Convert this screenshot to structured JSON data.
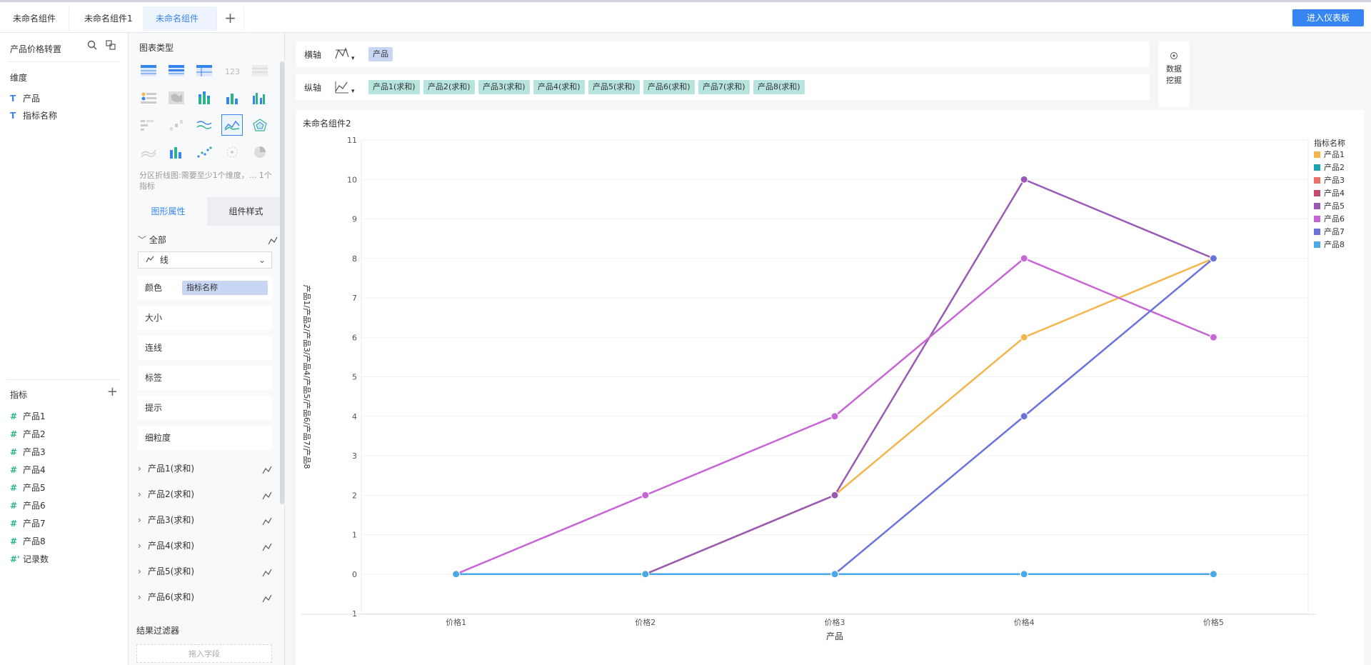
{
  "tabs": [
    {
      "label": "未命名组件",
      "active": false
    },
    {
      "label": "未命名组件1",
      "active": false
    },
    {
      "label": "未命名组件2",
      "active": true
    }
  ],
  "add_tab_label": "+",
  "dashboard_button": "进入仪表板",
  "field_panel": {
    "dataset_name": "产品价格转置",
    "dimension_title": "维度",
    "dimensions": [
      "产品",
      "指标名称"
    ],
    "measure_title": "指标",
    "measures": [
      "产品1",
      "产品2",
      "产品3",
      "产品4",
      "产品5",
      "产品6",
      "产品7",
      "产品8",
      "记录数"
    ]
  },
  "config_panel": {
    "chart_type_title": "图表类型",
    "hint": "分区折线图:需要至少1个维度，... 1个指标",
    "tab_graph": "图形属性",
    "tab_style": "组件样式",
    "all_label": "全部",
    "mark_type": "线",
    "props": {
      "color": "颜色",
      "color_field": "指标名称",
      "size": "大小",
      "connect": "连线",
      "label": "标签",
      "tooltip": "提示",
      "granularity": "细粒度"
    },
    "series": [
      "产品1(求和)",
      "产品2(求和)",
      "产品3(求和)",
      "产品4(求和)",
      "产品5(求和)",
      "产品6(求和)"
    ],
    "filter_title": "结果过滤器",
    "drop_hint": "拖入字段"
  },
  "shelves": {
    "x_label": "横轴",
    "x_pills": [
      "产品"
    ],
    "y_label": "纵轴",
    "y_pills": [
      "产品1(求和)",
      "产品2(求和)",
      "产品3(求和)",
      "产品4(求和)",
      "产品5(求和)",
      "产品6(求和)",
      "产品7(求和)",
      "产品8(求和)"
    ]
  },
  "mining_label": "数据挖掘",
  "chart_title": "未命名组件2",
  "chart_data": {
    "type": "line",
    "categories": [
      "价格1",
      "价格2",
      "价格3",
      "价格4",
      "价格5"
    ],
    "xlabel": "产品",
    "ylabel": "产品1/产品2/产品3/产品4/产品5/产品6/产品7/产品8",
    "ylim": [
      -1,
      11
    ],
    "yticks": [
      -1,
      0,
      1,
      2,
      3,
      4,
      5,
      6,
      7,
      8,
      9,
      10,
      11
    ],
    "legend_title": "指标名称",
    "legend_position": "right",
    "series": [
      {
        "name": "产品1",
        "color": "#f5b54a",
        "values": [
          0,
          0,
          2,
          6,
          8
        ]
      },
      {
        "name": "产品2",
        "color": "#1ba3b3",
        "values": [
          0,
          0,
          0,
          0,
          0
        ]
      },
      {
        "name": "产品3",
        "color": "#f0706a",
        "values": [
          0,
          0,
          0,
          0,
          0
        ]
      },
      {
        "name": "产品4",
        "color": "#c24a6e",
        "values": [
          0,
          0,
          0,
          0,
          0
        ]
      },
      {
        "name": "产品5",
        "color": "#9b59b6",
        "values": [
          0,
          0,
          2,
          10,
          8
        ]
      },
      {
        "name": "产品6",
        "color": "#c865d6",
        "values": [
          0,
          2,
          4,
          8,
          6
        ]
      },
      {
        "name": "产品7",
        "color": "#6b73db",
        "values": [
          0,
          0,
          0,
          4,
          8
        ]
      },
      {
        "name": "产品8",
        "color": "#4aa9e6",
        "values": [
          0,
          0,
          0,
          0,
          0
        ]
      }
    ]
  }
}
